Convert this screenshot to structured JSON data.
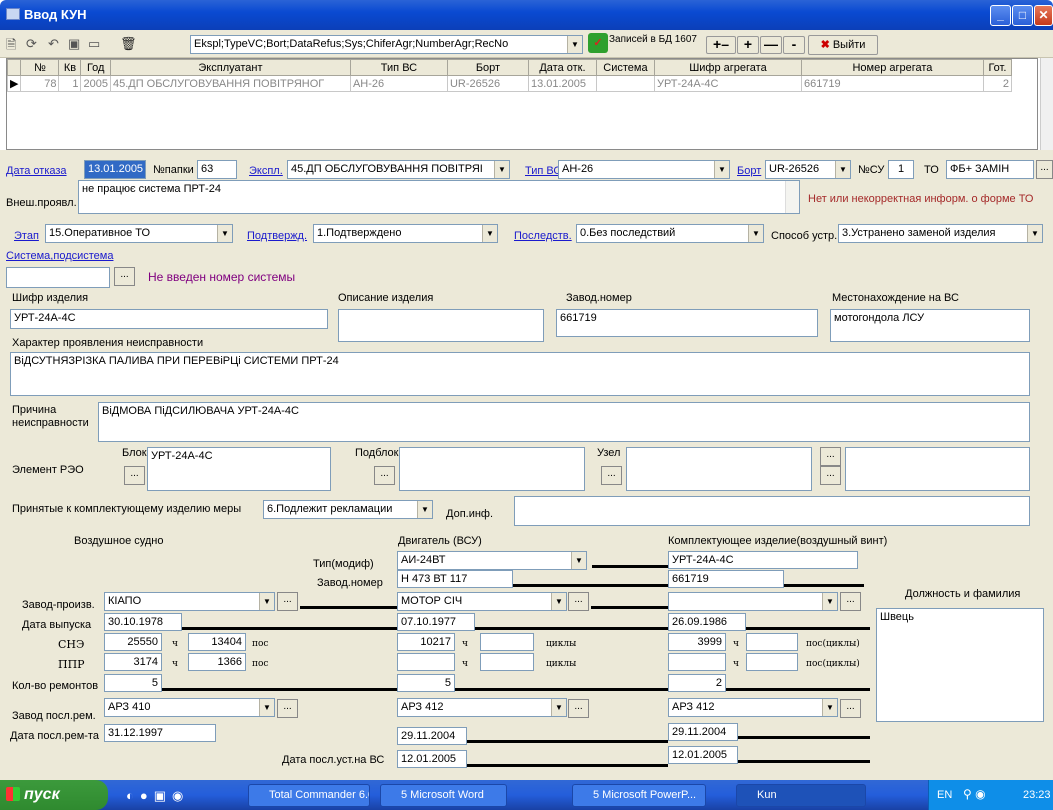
{
  "window": {
    "title": "Ввод КУН"
  },
  "toolbar": {
    "fields_combo": "Ekspl;TypeVC;Bort;DataRefus;Sys;ChiferAgr;NumberAgr;RecNo",
    "records_text": "Записей в БД 1607",
    "plusminus": "+–",
    "plus": "+",
    "minus": "—",
    "minus2": "-",
    "exit_label": "Выйти"
  },
  "grid": {
    "columns": [
      "№",
      "Кв",
      "Год",
      "Эксплуатант",
      "Тип ВС",
      "Борт",
      "Дата отк.",
      "Система",
      "Шифр агрегата",
      "Номер агрегата",
      "Гот."
    ],
    "rows": [
      [
        "78",
        "1",
        "2005",
        "45.ДП ОБСЛУГОВУВАННЯ ПОВІТРЯНОГ",
        "АН-26",
        "UR-26526",
        "13.01.2005",
        "",
        "УРТ-24А-4С",
        "661719",
        "2"
      ]
    ]
  },
  "form": {
    "date_label": "Дата отказа",
    "date_value": "13.01.2005",
    "folder_label": "№папки",
    "folder_value": "63",
    "ekspl_label": "Экспл.",
    "ekspl_value": "45.ДП ОБСЛУГОВУВАННЯ ПОВІТРЯІ",
    "type_label": "Тип ВС",
    "type_value": "АН-26",
    "bort_label": "Борт",
    "bort_value": "UR-26526",
    "nsu_label": "№СУ",
    "nsu_value": "1",
    "to_label": "ТО",
    "to_value": "ФБ+ ЗАМІН",
    "vnesh_label": "Внеш.проявл.",
    "vnesh_value": "не працює система ПРТ-24",
    "warning": "Нет или некорректная информ. о форме ТО",
    "etap_label": "Этап",
    "etap_value": "15.Оперативное ТО",
    "podtv_label": "Подтвержд.",
    "podtv_value": "1.Подтверждено",
    "posled_label": "Последств.",
    "posled_value": "0.Без последствий",
    "sposob_label": "Способ устр.",
    "sposob_value": "3.Устранено заменой изделия",
    "sistema_label": "Система,подсистема",
    "sistema_warning": "Не введен номер системы",
    "shifr_label": "Шифр изделия",
    "shifr_value": "УРТ-24А-4С",
    "opis_label": "Описание изделия",
    "zavnom_label": "Завод.номер",
    "zavnom_value": "661719",
    "mesto_label": "Местонахождение на ВС",
    "mesto_value": "мотогондола ЛСУ",
    "harakter_label": "Характер проявления неисправности",
    "harakter_value": "ВіДСУТНЯЗРІЗКА ПАЛИВА ПРИ ПЕРЕВіРЦі СИСТЕМИ ПРТ-24",
    "prichina_label1": "Причина",
    "prichina_label2": "неисправности",
    "prichina_value": "ВіДМОВА ПіДСИЛЮВАЧА УРТ-24А-4С",
    "element_label": "Элемент РЭО",
    "blok_label": "Блок",
    "blok_value": "УРТ-24А-4С",
    "podblok_label": "Подблок",
    "uzel_label": "Узел",
    "mery_label": "Принятые к комплектующему изделию меры",
    "mery_value": "6.Подлежит рекламации",
    "dopinf_label": "Доп.инф.",
    "vs_header": "Воздушное судно",
    "dv_header": "Двигатель (ВСУ)",
    "ki_header": "Комплектующее изделие(воздушный винт)",
    "tip_modif_label": "Тип(модиф)",
    "zavnom2_label": "Завод.номер",
    "dv_tip": "АИ-24ВТ",
    "dv_nom": "Н 473 ВТ 117",
    "ki_tip": "УРТ-24А-4С",
    "ki_nom": "661719",
    "zavod_proizv_label": "Завод-произв.",
    "vs_zavod": "КІАПО",
    "dv_zavod": "МОТОР СІЧ",
    "dolzhnost_label": "Должность и фамилия",
    "dolzhnost_value": "Швець",
    "data_vyp_label": "Дата выпуска",
    "vs_data_vyp": "30.10.1978",
    "dv_data_vyp": "07.10.1977",
    "ki_data_vyp": "26.09.1986",
    "sne_label": "СНЭ",
    "vs_sne_h": "25550",
    "vs_sne_p": "13404",
    "dv_sne_h": "10217",
    "ki_sne_h": "3999",
    "ppr_label": "ППР",
    "vs_ppr_h": "3174",
    "vs_ppr_p": "1366",
    "ch": "ч",
    "pos": "пос",
    "cikly": "циклы",
    "pos_cikly": "пос(циклы)",
    "kolvo_label": "Кол-во ремонтов",
    "vs_kolvo": "5",
    "dv_kolvo": "5",
    "ki_kolvo": "2",
    "zavod_rem_label": "Завод посл.рем.",
    "vs_zavod_rem": "АРЗ 410",
    "dv_zavod_rem": "АРЗ 412",
    "ki_zavod_rem": "АРЗ 412",
    "data_rem_label": "Дата посл.рем-та",
    "vs_data_rem": "31.12.1997",
    "dv_data_rem": "29.11.2004",
    "ki_data_rem": "29.11.2004",
    "data_ust_label": "Дата посл.уст.на ВС",
    "dv_data_ust": "12.01.2005",
    "ki_data_ust": "12.01.2005"
  },
  "taskbar": {
    "start": "пуск",
    "tasks": [
      "Total Commander 6.0...",
      "5 Microsoft Word",
      "5 Microsoft PowerP...",
      "Kun"
    ],
    "lang": "EN",
    "time": "23:23"
  }
}
